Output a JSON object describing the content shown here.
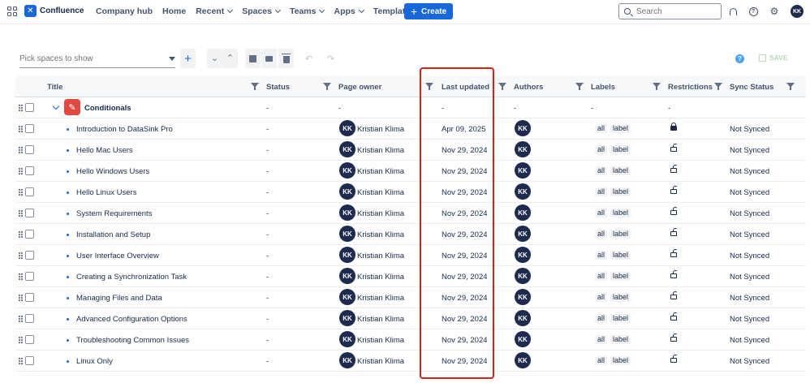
{
  "nav": {
    "brand": "Confluence",
    "links": [
      {
        "label": "Company hub",
        "dropdown": false
      },
      {
        "label": "Home",
        "dropdown": false
      },
      {
        "label": "Recent",
        "dropdown": true
      },
      {
        "label": "Spaces",
        "dropdown": true
      },
      {
        "label": "Teams",
        "dropdown": true
      },
      {
        "label": "Apps",
        "dropdown": true
      },
      {
        "label": "Templates",
        "dropdown": false
      }
    ],
    "create_label": "Create",
    "search_placeholder": "Search",
    "user_initials": "KK"
  },
  "toolbar": {
    "space_picker_placeholder": "Pick spaces to show",
    "save_label": "SAVE"
  },
  "columns": {
    "title": "Title",
    "status": "Status",
    "page_owner": "Page owner",
    "last_updated": "Last updated",
    "authors": "Authors",
    "labels": "Labels",
    "restrictions": "Restrictions",
    "sync_status": "Sync Status"
  },
  "space_row": {
    "title": "Conditionals",
    "status": "-",
    "page_owner": "-",
    "last_updated": "-",
    "authors": "-",
    "labels": "-",
    "restrictions": "-"
  },
  "rows": [
    {
      "title": "Introduction to DataSink Pro",
      "status": "-",
      "owner_initials": "KK",
      "owner": "Kristian Klima",
      "last_updated": "Apr 09, 2025",
      "author_initials": "KK",
      "labels": [
        "all",
        "label"
      ],
      "restricted": true,
      "sync_status": "Not Synced"
    },
    {
      "title": "Hello Mac Users",
      "status": "-",
      "owner_initials": "KK",
      "owner": "Kristian Klima",
      "last_updated": "Nov 29, 2024",
      "author_initials": "KK",
      "labels": [
        "all",
        "label"
      ],
      "restricted": false,
      "sync_status": "Not Synced"
    },
    {
      "title": "Hello Windows Users",
      "status": "-",
      "owner_initials": "KK",
      "owner": "Kristian Klima",
      "last_updated": "Nov 29, 2024",
      "author_initials": "KK",
      "labels": [
        "all",
        "label"
      ],
      "restricted": false,
      "sync_status": "Not Synced"
    },
    {
      "title": "Hello Linux Users",
      "status": "-",
      "owner_initials": "KK",
      "owner": "Kristian Klima",
      "last_updated": "Nov 29, 2024",
      "author_initials": "KK",
      "labels": [
        "all",
        "label"
      ],
      "restricted": false,
      "sync_status": "Not Synced"
    },
    {
      "title": "System Requirements",
      "status": "-",
      "owner_initials": "KK",
      "owner": "Kristian Klima",
      "last_updated": "Nov 29, 2024",
      "author_initials": "KK",
      "labels": [
        "all",
        "label"
      ],
      "restricted": false,
      "sync_status": "Not Synced"
    },
    {
      "title": "Installation and Setup",
      "status": "-",
      "owner_initials": "KK",
      "owner": "Kristian Klima",
      "last_updated": "Nov 29, 2024",
      "author_initials": "KK",
      "labels": [
        "all",
        "label"
      ],
      "restricted": false,
      "sync_status": "Not Synced"
    },
    {
      "title": "User Interface Overview",
      "status": "-",
      "owner_initials": "KK",
      "owner": "Kristian Klima",
      "last_updated": "Nov 29, 2024",
      "author_initials": "KK",
      "labels": [
        "all",
        "label"
      ],
      "restricted": false,
      "sync_status": "Not Synced"
    },
    {
      "title": "Creating a Synchronization Task",
      "status": "-",
      "owner_initials": "KK",
      "owner": "Kristian Klima",
      "last_updated": "Nov 29, 2024",
      "author_initials": "KK",
      "labels": [
        "all",
        "label"
      ],
      "restricted": false,
      "sync_status": "Not Synced"
    },
    {
      "title": "Managing Files and Data",
      "status": "-",
      "owner_initials": "KK",
      "owner": "Kristian Klima",
      "last_updated": "Nov 29, 2024",
      "author_initials": "KK",
      "labels": [
        "all",
        "label"
      ],
      "restricted": false,
      "sync_status": "Not Synced"
    },
    {
      "title": "Advanced Configuration Options",
      "status": "-",
      "owner_initials": "KK",
      "owner": "Kristian Klima",
      "last_updated": "Nov 29, 2024",
      "author_initials": "KK",
      "labels": [
        "all",
        "label"
      ],
      "restricted": false,
      "sync_status": "Not Synced"
    },
    {
      "title": "Troubleshooting Common Issues",
      "status": "-",
      "owner_initials": "KK",
      "owner": "Kristian Klima",
      "last_updated": "Nov 29, 2024",
      "author_initials": "KK",
      "labels": [
        "all",
        "label"
      ],
      "restricted": false,
      "sync_status": "Not Synced"
    },
    {
      "title": "Linux Only",
      "status": "-",
      "owner_initials": "KK",
      "owner": "Kristian Klima",
      "last_updated": "Nov 29, 2024",
      "author_initials": "KK",
      "labels": [
        "all",
        "label"
      ],
      "restricted": false,
      "sync_status": "Not Synced"
    }
  ],
  "colors": {
    "brand": "#1868db",
    "highlight": "#d9201a",
    "avatar": "#1d2b4f",
    "space_icon": "#e2483d"
  }
}
